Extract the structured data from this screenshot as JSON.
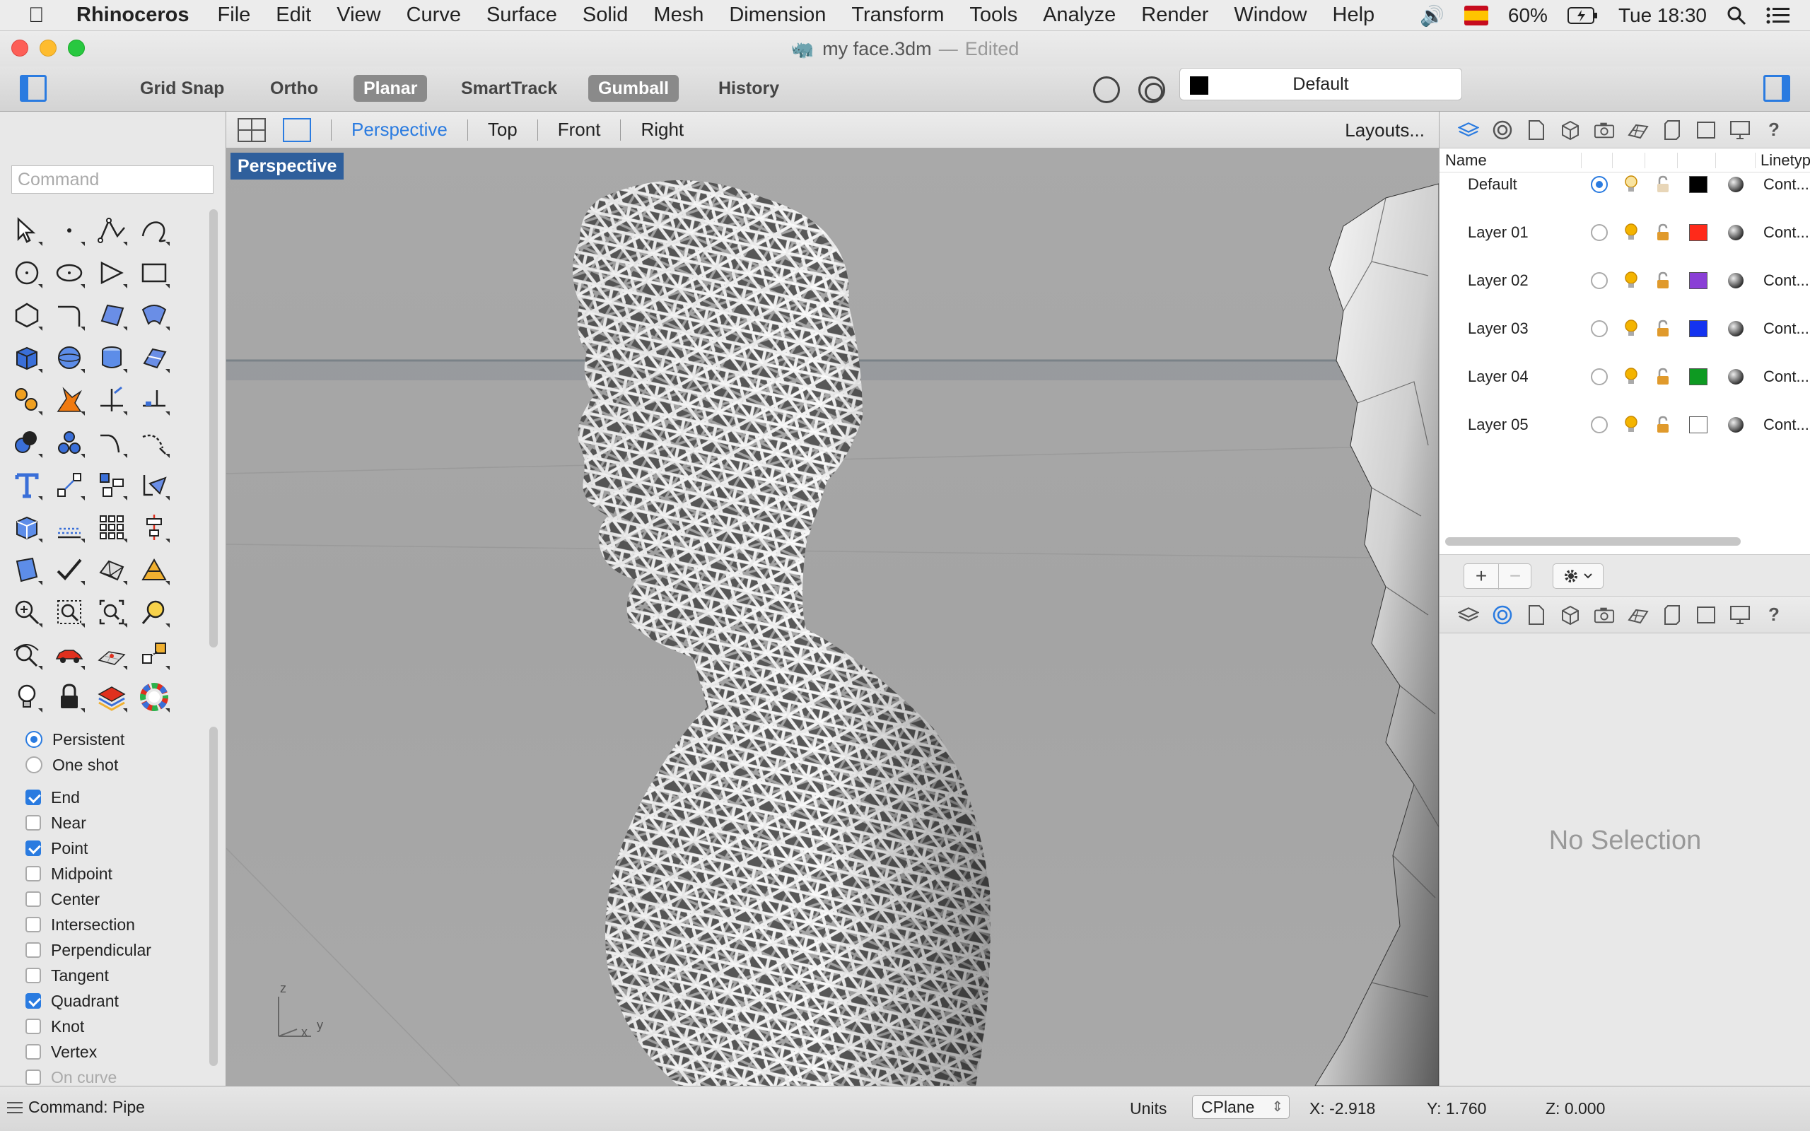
{
  "menubar": {
    "app_name": "Rhinoceros",
    "items": [
      "File",
      "Edit",
      "View",
      "Curve",
      "Surface",
      "Solid",
      "Mesh",
      "Dimension",
      "Transform",
      "Tools",
      "Analyze",
      "Render",
      "Window",
      "Help"
    ],
    "battery": "60%",
    "clock": "Tue 18:30"
  },
  "titlebar": {
    "document": "my face.3dm",
    "separator": "—",
    "state": "Edited"
  },
  "toolbar": {
    "grid_snap": "Grid Snap",
    "ortho": "Ortho",
    "planar": "Planar",
    "smarttrack": "SmartTrack",
    "gumball": "Gumball",
    "history": "History",
    "current_layer": "Default",
    "current_layer_color": "#000000"
  },
  "left_panel": {
    "command_placeholder": "Command",
    "osnap_modes": [
      {
        "label": "Persistent",
        "kind": "radio",
        "checked": true
      },
      {
        "label": "One shot",
        "kind": "radio",
        "checked": false
      }
    ],
    "osnaps": [
      {
        "label": "End",
        "checked": true
      },
      {
        "label": "Near",
        "checked": false
      },
      {
        "label": "Point",
        "checked": true
      },
      {
        "label": "Midpoint",
        "checked": false
      },
      {
        "label": "Center",
        "checked": false
      },
      {
        "label": "Intersection",
        "checked": false
      },
      {
        "label": "Perpendicular",
        "checked": false
      },
      {
        "label": "Tangent",
        "checked": false
      },
      {
        "label": "Quadrant",
        "checked": true
      },
      {
        "label": "Knot",
        "checked": false
      },
      {
        "label": "Vertex",
        "checked": false
      },
      {
        "label": "On curve",
        "checked": false
      }
    ]
  },
  "viewtabs": {
    "tabs": [
      "Perspective",
      "Top",
      "Front",
      "Right"
    ],
    "active": "Perspective",
    "layouts": "Layouts..."
  },
  "viewport": {
    "label": "Perspective",
    "axis_z": "z",
    "axis_x": "x",
    "axis_y": "y"
  },
  "layers": {
    "col_name": "Name",
    "col_linetype": "Linetyp",
    "rows": [
      {
        "name": "Default",
        "color": "#000000",
        "linetype": "Cont...",
        "current": true
      },
      {
        "name": "Layer 01",
        "color": "#ff2a1a",
        "linetype": "Cont...",
        "current": false
      },
      {
        "name": "Layer 02",
        "color": "#8a3fd6",
        "linetype": "Cont...",
        "current": false
      },
      {
        "name": "Layer 03",
        "color": "#1433f0",
        "linetype": "Cont...",
        "current": false
      },
      {
        "name": "Layer 04",
        "color": "#0e9a22",
        "linetype": "Cont...",
        "current": false
      },
      {
        "name": "Layer 05",
        "color": "#ffffff",
        "linetype": "Cont...",
        "current": false
      }
    ]
  },
  "properties": {
    "empty_text": "No Selection"
  },
  "statusbar": {
    "command": "Command: Pipe",
    "units": "Units",
    "cplane": "CPlane",
    "x": "X: -2.918",
    "y": "Y: 1.760",
    "z": "Z: 0.000"
  }
}
